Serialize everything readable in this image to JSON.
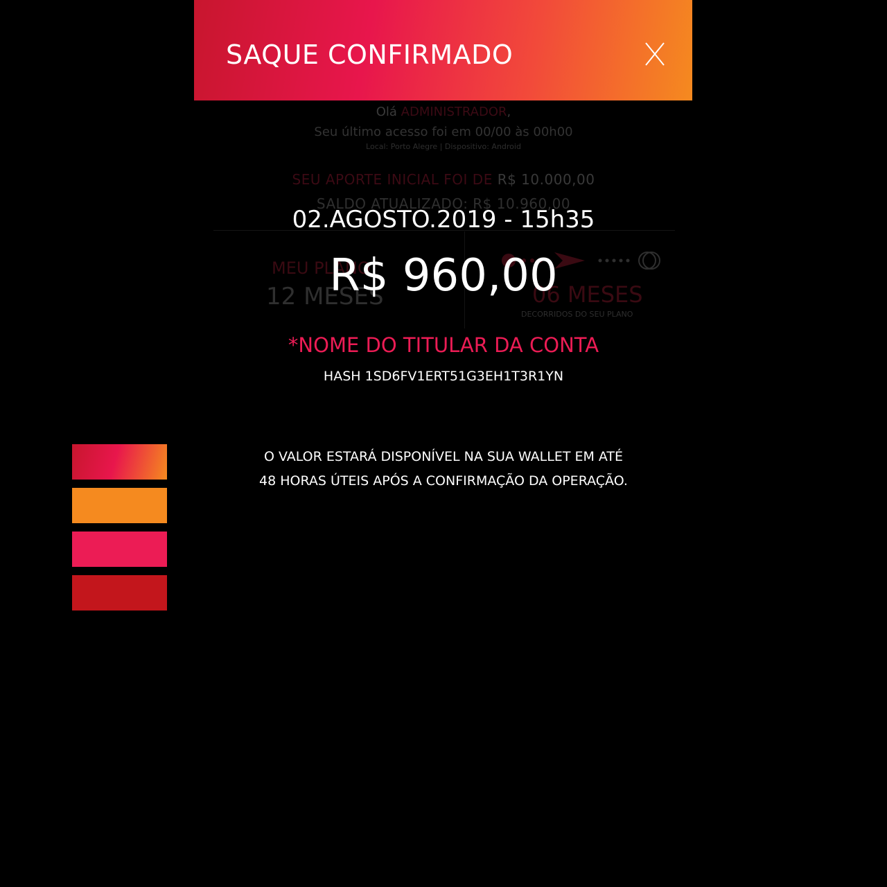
{
  "background": {
    "greeting_prefix": "Olá",
    "greeting_name": "ADMINISTRADOR",
    "greeting_suffix": ",",
    "last_access": "Seu último acesso foi em 00/00 às 00h00",
    "location_device": "Local: Porto Alegre | Dispositivo: Android",
    "initial_contribution_label": "SEU APORTE INICIAL FOI DE",
    "initial_contribution_value": "R$ 10.000,00",
    "balance": "SALDO ATUALIZADO: R$ 10.960,00",
    "plan_label": "MEU PLANO",
    "plan_value": "12 MESES",
    "elapsed_value": "06 MESES",
    "elapsed_label": "DECORRIDOS DO SEU PLANO"
  },
  "modal": {
    "title": "SAQUE CONFIRMADO",
    "close_label": "X",
    "datetime": "02.AGOSTO.2019 - 15h35",
    "amount": "R$ 960,00",
    "holder": "*NOME DO TITULAR DA CONTA",
    "hash": "HASH 1SD6FV1ERT51G3EH1T3R1YN",
    "notice_line1": "O VALOR ESTARÁ DISPONÍVEL NA SUA WALLET EM ATÉ",
    "notice_line2": "48 HORAS ÚTEIS APÓS A CONFIRMAÇÃO DA OPERAÇÃO."
  },
  "colors": {
    "gradient_start": "#c8162e",
    "gradient_mid": "#e8164c",
    "gradient_end": "#f58a1f",
    "orange": "#f58a1f",
    "pink": "#ec1c55",
    "red": "#c3161c",
    "background": "#000000"
  },
  "swatches": [
    "gradient",
    "#f58a1f",
    "#ec1c55",
    "#c3161c"
  ]
}
